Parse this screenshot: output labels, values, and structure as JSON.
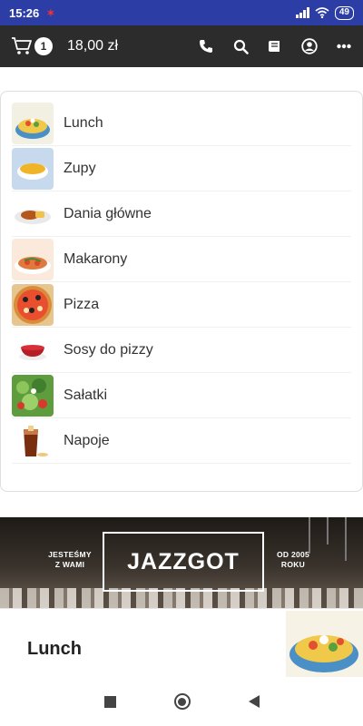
{
  "status_bar": {
    "time": "15:26",
    "notification": "✶",
    "battery": "49"
  },
  "app_bar": {
    "cart_count": "1",
    "cart_total": "18,00 zł",
    "actions": [
      "phone-icon",
      "search-icon",
      "book-icon",
      "account-icon",
      "more-icon"
    ]
  },
  "menu": {
    "items": [
      {
        "label": "Lunch",
        "icon": "lunch-thumbnail"
      },
      {
        "label": "Zupy",
        "icon": "soup-thumbnail"
      },
      {
        "label": "Dania główne",
        "icon": "main-dish-thumbnail"
      },
      {
        "label": "Makarony",
        "icon": "pasta-thumbnail"
      },
      {
        "label": "Pizza",
        "icon": "pizza-thumbnail"
      },
      {
        "label": "Sosy do pizzy",
        "icon": "sauce-thumbnail"
      },
      {
        "label": "Sałatki",
        "icon": "salad-thumbnail"
      },
      {
        "label": "Napoje",
        "icon": "drink-thumbnail"
      }
    ]
  },
  "banner": {
    "left_text": "JESTEŚMY\nZ WAMI",
    "brand": "JAZZGOT",
    "right_text": "OD 2005\nROKU"
  },
  "section": {
    "title": "Lunch"
  },
  "colors": {
    "status_bar": "#2c3ea6",
    "app_bar": "#2c2c2c"
  }
}
